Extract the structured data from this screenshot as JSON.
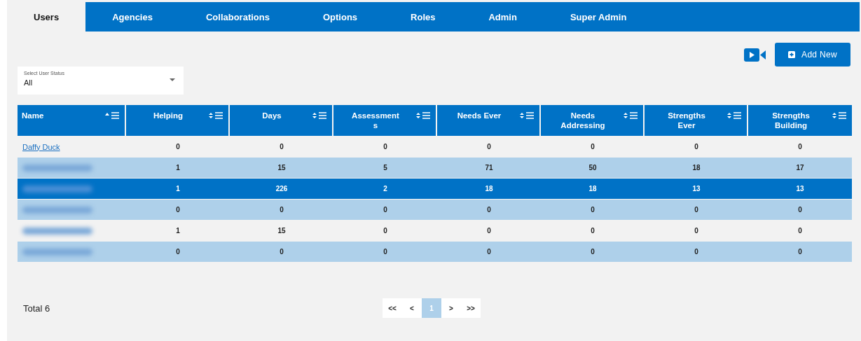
{
  "tabs": [
    {
      "label": "Users",
      "selected": true
    },
    {
      "label": "Agencies",
      "selected": false
    },
    {
      "label": "Collaborations",
      "selected": false
    },
    {
      "label": "Options",
      "selected": false
    },
    {
      "label": "Roles",
      "selected": false
    },
    {
      "label": "Admin",
      "selected": false
    },
    {
      "label": "Super Admin",
      "selected": false
    }
  ],
  "add_button": {
    "label": "Add New"
  },
  "status_select": {
    "label": "Select User Status",
    "value": "All"
  },
  "table": {
    "columns": [
      {
        "label": "Name",
        "sort_ascending": true
      },
      {
        "label": "Helping",
        "sort_ascending": false
      },
      {
        "label": "Days",
        "sort_ascending": false
      },
      {
        "label": "Assessment\ns",
        "sort_ascending": false
      },
      {
        "label": "Needs Ever",
        "sort_ascending": false
      },
      {
        "label": "Needs\nAddressing",
        "sort_ascending": false
      },
      {
        "label": "Strengths\nEver",
        "sort_ascending": false
      },
      {
        "label": "Strengths\nBuilding",
        "sort_ascending": false
      }
    ],
    "rows": [
      {
        "selected": false,
        "name": {
          "kind": "link",
          "text": "Daffy Duck"
        },
        "values": [
          "0",
          "0",
          "0",
          "0",
          "0",
          "0",
          "0"
        ]
      },
      {
        "selected": false,
        "name": {
          "kind": "redacted"
        },
        "values": [
          "1",
          "15",
          "5",
          "71",
          "50",
          "18",
          "17"
        ]
      },
      {
        "selected": true,
        "name": {
          "kind": "redacted"
        },
        "values": [
          "1",
          "226",
          "2",
          "18",
          "18",
          "13",
          "13"
        ]
      },
      {
        "selected": false,
        "name": {
          "kind": "redacted"
        },
        "values": [
          "0",
          "0",
          "0",
          "0",
          "0",
          "0",
          "0"
        ]
      },
      {
        "selected": false,
        "name": {
          "kind": "redacted"
        },
        "values": [
          "1",
          "15",
          "0",
          "0",
          "0",
          "0",
          "0"
        ]
      },
      {
        "selected": false,
        "name": {
          "kind": "redacted"
        },
        "values": [
          "0",
          "0",
          "0",
          "0",
          "0",
          "0",
          "0"
        ]
      }
    ]
  },
  "total": "Total 6",
  "pagination": [
    {
      "label": "<<",
      "selected": false
    },
    {
      "label": "<",
      "selected": false
    },
    {
      "label": "1",
      "selected": true
    },
    {
      "label": ">",
      "selected": false
    },
    {
      "label": ">>",
      "selected": false
    }
  ]
}
